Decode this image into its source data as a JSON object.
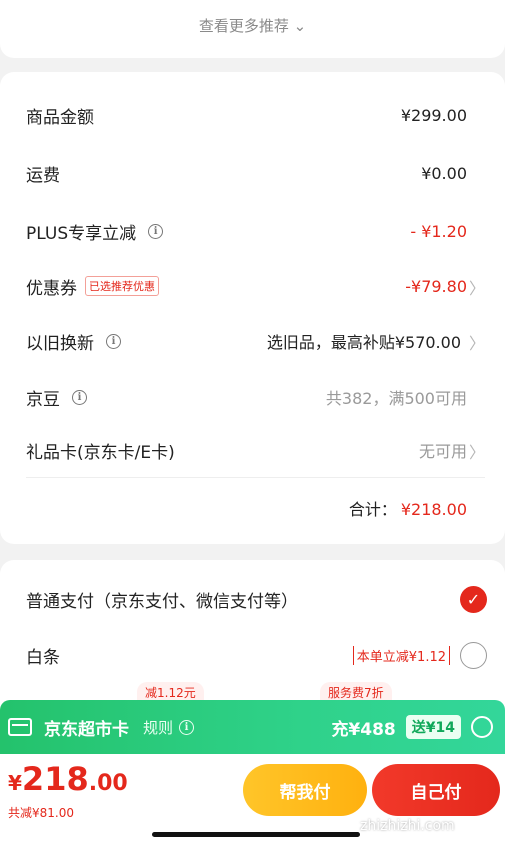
{
  "top": {
    "see_more": "查看更多推荐 ⌄"
  },
  "price": {
    "rows": [
      {
        "label": "商品金额",
        "value": "¥299.00"
      },
      {
        "label": "运费",
        "value": "¥0.00"
      },
      {
        "label": "PLUS专享立减",
        "value": "- ¥1.20"
      },
      {
        "label": "优惠券",
        "tag": "已选推荐优惠",
        "value": "-¥79.80"
      },
      {
        "label": "以旧换新",
        "value": "选旧品，最高补贴¥570.00"
      },
      {
        "label": "京豆",
        "value": "共382，满500可用"
      },
      {
        "label": "礼品卡(京东卡/E卡)",
        "value": "无可用"
      }
    ],
    "total_label": "合计：",
    "total_value": "¥218.00"
  },
  "payment": {
    "normal": "普通支付（京东支付、微信支付等）",
    "baitiao": "白条",
    "baitiao_promo": "本单立减¥1.12",
    "tag_left": "减1.12元",
    "tag_right": "服务费7折"
  },
  "supermarket": {
    "title": "京东超市卡",
    "rule": "规则",
    "charge": "充¥488",
    "gift": "送¥14"
  },
  "bottom": {
    "currency": "¥",
    "int": "218",
    "dec": ".00",
    "saved": "共减¥81.00",
    "help_pay": "帮我付",
    "self_pay": "自己付"
  },
  "watermark": "zhizhizhi.com",
  "colors": {
    "accent": "#e4281c",
    "green": "#24c26c",
    "yellow": "#ffb10f"
  }
}
